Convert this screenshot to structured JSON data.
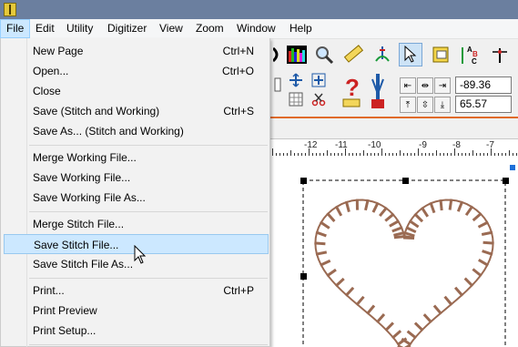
{
  "menubar": {
    "items": [
      "File",
      "Edit",
      "Utility",
      "Digitizer",
      "View",
      "Zoom",
      "Window",
      "Help"
    ]
  },
  "file_menu": {
    "groups": [
      [
        {
          "label": "New Page",
          "shortcut": "Ctrl+N"
        },
        {
          "label": "Open...",
          "shortcut": "Ctrl+O"
        },
        {
          "label": "Close",
          "shortcut": ""
        },
        {
          "label": "Save (Stitch and Working)",
          "shortcut": "Ctrl+S"
        },
        {
          "label": "Save As... (Stitch and Working)",
          "shortcut": ""
        }
      ],
      [
        {
          "label": "Merge Working File...",
          "shortcut": ""
        },
        {
          "label": "Save Working File...",
          "shortcut": ""
        },
        {
          "label": "Save Working File As...",
          "shortcut": ""
        }
      ],
      [
        {
          "label": "Merge Stitch File...",
          "shortcut": ""
        },
        {
          "label": "Save Stitch File...",
          "shortcut": "",
          "highlighted": true
        },
        {
          "label": "Save Stitch File As...",
          "shortcut": ""
        }
      ],
      [
        {
          "label": "Print...",
          "shortcut": "Ctrl+P"
        },
        {
          "label": "Print Preview",
          "shortcut": ""
        },
        {
          "label": "Print Setup...",
          "shortcut": ""
        }
      ]
    ]
  },
  "coords": {
    "x": "-89.36",
    "y": "65.57"
  },
  "ruler": {
    "labels": [
      "-12",
      "-11",
      "-10",
      "-9",
      "-8",
      "-7"
    ]
  },
  "colors": {
    "highlight": "#cce8ff",
    "stitch": "#9a6a52",
    "titlebar": "#6b7f9f"
  }
}
